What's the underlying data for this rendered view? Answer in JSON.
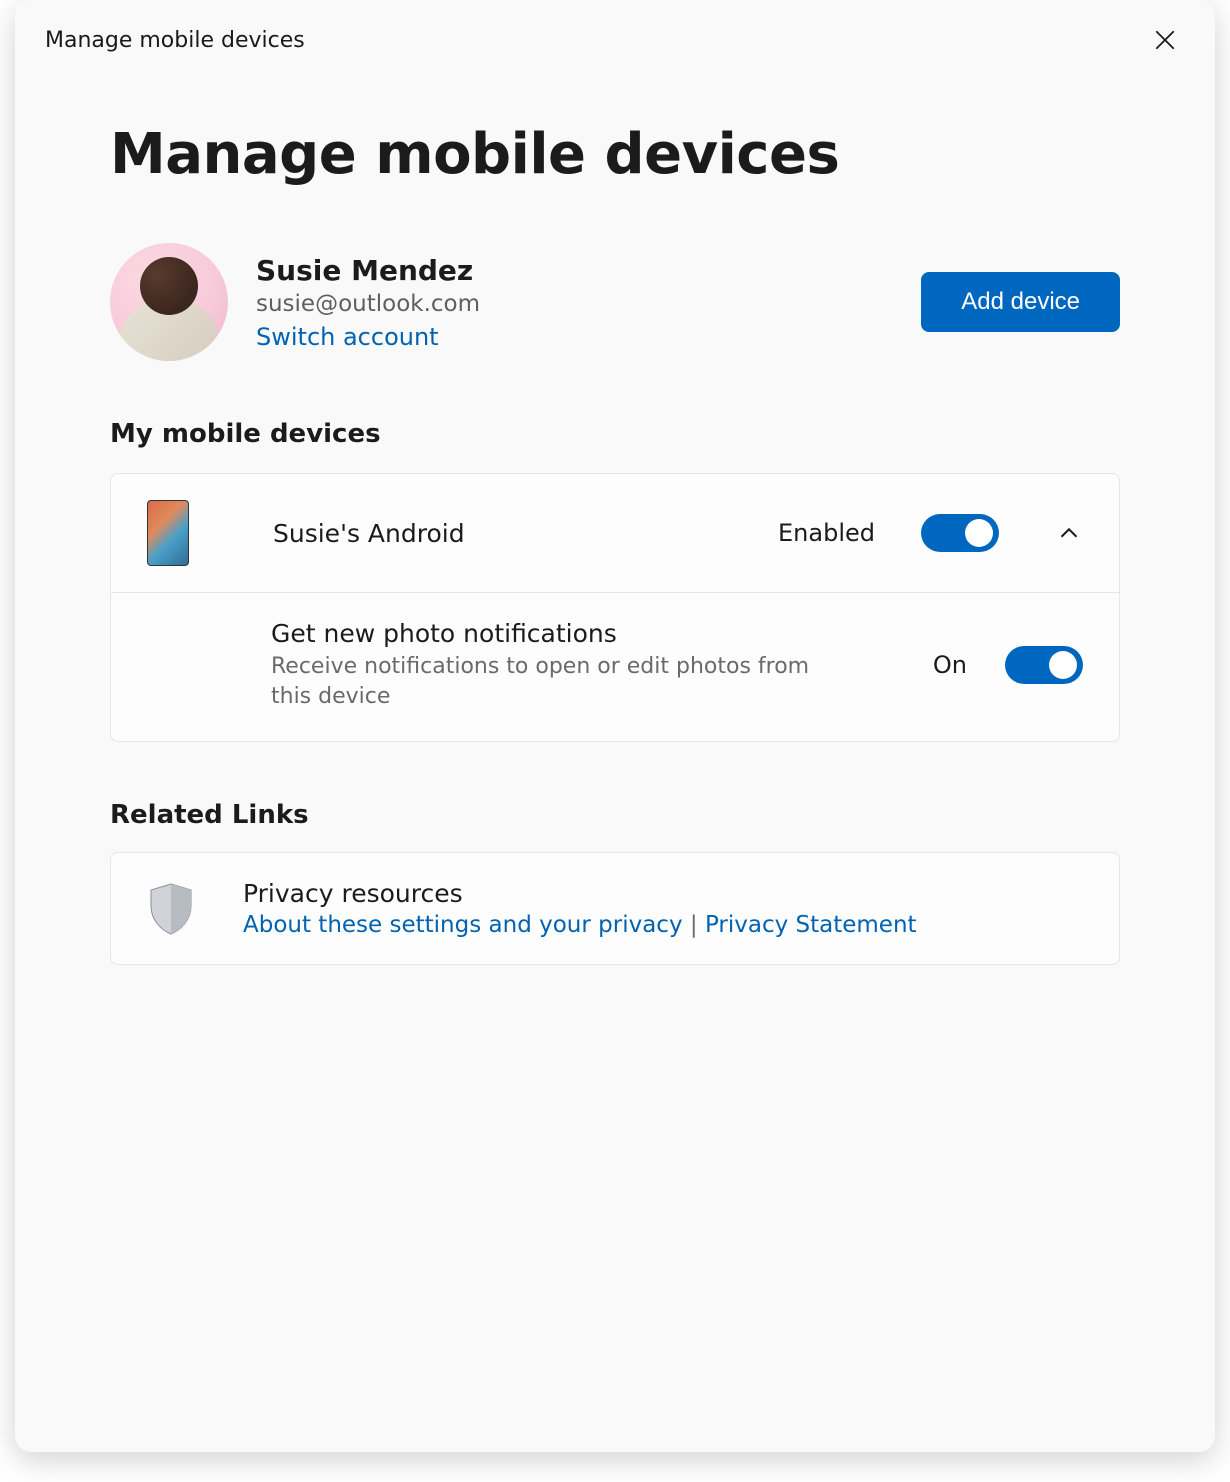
{
  "window": {
    "title": "Manage mobile devices"
  },
  "header": {
    "page_title": "Manage mobile devices"
  },
  "account": {
    "name": "Susie Mendez",
    "email": "susie@outlook.com",
    "switch_label": "Switch account",
    "add_device_label": "Add device"
  },
  "sections": {
    "devices_title": "My mobile devices",
    "related_title": "Related Links"
  },
  "device": {
    "name": "Susie's Android",
    "status_label": "Enabled",
    "setting_title": "Get new photo notifications",
    "setting_desc": "Receive notifications to open or edit photos from this device",
    "setting_status": "On"
  },
  "related": {
    "title": "Privacy resources",
    "link1": "About these settings and your privacy",
    "separator": " | ",
    "link2": "Privacy Statement"
  },
  "colors": {
    "accent": "#0067c0",
    "link": "#0062b1"
  }
}
